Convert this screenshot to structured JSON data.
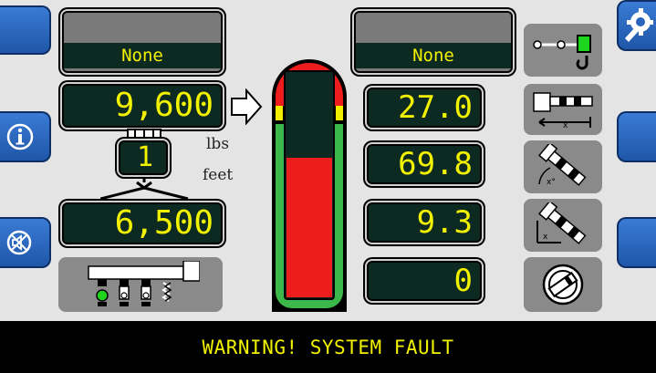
{
  "hook_load": {
    "name_left": "None",
    "name_right": "None"
  },
  "left": {
    "actual_load": "9,600",
    "parts_of_line": "1",
    "rated_capacity": "6,500"
  },
  "units": {
    "load": "lbs",
    "length": "feet"
  },
  "right": {
    "values": [
      "27.0",
      "69.8",
      "9.3",
      "0"
    ]
  },
  "warning": "WARNING! SYSTEM FAULT",
  "load_gauge": {
    "percent_of_capacity": 0.62
  },
  "icons": {
    "left_tabs": [
      "blank-tab",
      "info-icon",
      "alarm-mute-icon"
    ],
    "right_tabs": [
      "settings-icon",
      "blank-tab",
      "blank-tab"
    ],
    "right_buttons": [
      "anti-two-block-icon",
      "radius-icon",
      "boom-angle-icon",
      "boom-length-icon",
      "slew-icon"
    ],
    "outrigger": "outrigger-icon"
  },
  "colors": {
    "lcd_bg": "#0d2a22",
    "lcd_text": "#f2f200",
    "gauge_red": "#ee1d1d",
    "gauge_green": "#3cb84a",
    "gauge_yellow": "#f2ee00"
  }
}
